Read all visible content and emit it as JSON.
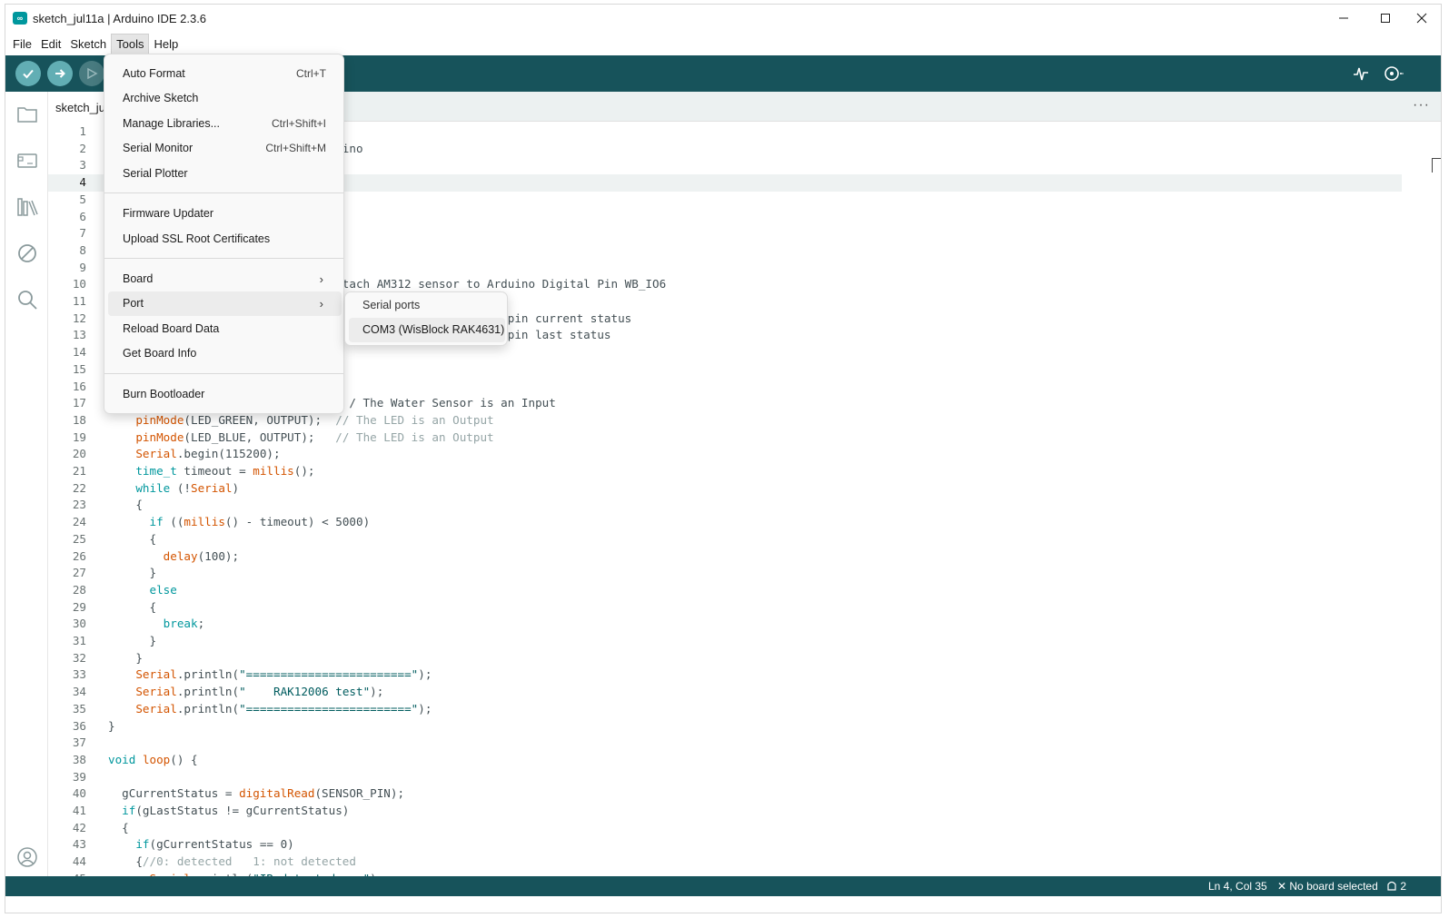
{
  "window": {
    "title": "sketch_jul11a | Arduino IDE 2.3.6",
    "logo_text": "∞",
    "minimize": "—",
    "maximize": "☐",
    "close": "✕"
  },
  "menubar": {
    "items": [
      "File",
      "Edit",
      "Sketch",
      "Tools",
      "Help"
    ],
    "active": "Tools"
  },
  "toolbar": {
    "verify_icon": "check-icon",
    "upload_icon": "arrow-right-icon",
    "debug_icon": "debug-icon",
    "serial_plotter_icon": "plotter-icon",
    "serial_monitor_icon": "monitor-icon"
  },
  "sidebar": {
    "icons": [
      "folder-icon",
      "board-icon",
      "library-icon",
      "debug-off-icon",
      "search-icon",
      "account-icon"
    ]
  },
  "tab": {
    "label": "sketch_jul",
    "more": "···"
  },
  "editor": {
    "current_line": 4,
    "lines": [
      {
        "n": "1",
        "code": ""
      },
      {
        "n": "2",
        "code": "                                  ino"
      },
      {
        "n": "3",
        "code": ""
      },
      {
        "n": "4",
        "code": ""
      },
      {
        "n": "5",
        "code": ""
      },
      {
        "n": "6",
        "code": ""
      },
      {
        "n": "7",
        "code": ""
      },
      {
        "n": "8",
        "code": ""
      },
      {
        "n": "9",
        "code": ""
      },
      {
        "n": "10",
        "code": "                                  tach AM312 sensor to Arduino Digital Pin WB_IO6"
      },
      {
        "n": "11",
        "code": ""
      },
      {
        "n": "12",
        "code": "                                                        e pin current status"
      },
      {
        "n": "13",
        "code": "                                                        e pin last status"
      },
      {
        "n": "14",
        "code": ""
      },
      {
        "n": "15",
        "code": ""
      },
      {
        "n": "16",
        "code": ""
      },
      {
        "n": "17",
        "code": "                                   / The Water Sensor is an Input"
      },
      {
        "n": "18",
        "code": "    pinMode(LED_GREEN, OUTPUT);  // The LED is an Output"
      },
      {
        "n": "19",
        "code": "    pinMode(LED_BLUE, OUTPUT);   // The LED is an Output"
      },
      {
        "n": "20",
        "code": "    Serial.begin(115200);"
      },
      {
        "n": "21",
        "code": "    time_t timeout = millis();"
      },
      {
        "n": "22",
        "code": "    while (!Serial)"
      },
      {
        "n": "23",
        "code": "    {"
      },
      {
        "n": "24",
        "code": "      if ((millis() - timeout) < 5000)"
      },
      {
        "n": "25",
        "code": "      {"
      },
      {
        "n": "26",
        "code": "        delay(100);"
      },
      {
        "n": "27",
        "code": "      }"
      },
      {
        "n": "28",
        "code": "      else"
      },
      {
        "n": "29",
        "code": "      {"
      },
      {
        "n": "30",
        "code": "        break;"
      },
      {
        "n": "31",
        "code": "      }"
      },
      {
        "n": "32",
        "code": "    }"
      },
      {
        "n": "33",
        "code": "    Serial.println(\"========================\");"
      },
      {
        "n": "34",
        "code": "    Serial.println(\"    RAK12006 test\");"
      },
      {
        "n": "35",
        "code": "    Serial.println(\"========================\");"
      },
      {
        "n": "36",
        "code": "}"
      },
      {
        "n": "37",
        "code": ""
      },
      {
        "n": "38",
        "code": "void loop() {"
      },
      {
        "n": "39",
        "code": ""
      },
      {
        "n": "40",
        "code": "  gCurrentStatus = digitalRead(SENSOR_PIN);"
      },
      {
        "n": "41",
        "code": "  if(gLastStatus != gCurrentStatus)"
      },
      {
        "n": "42",
        "code": "  {"
      },
      {
        "n": "43",
        "code": "    if(gCurrentStatus == 0)"
      },
      {
        "n": "44",
        "code": "    {//0: detected   1: not detected"
      },
      {
        "n": "45",
        "code": "      Serial.println(\"IR detected ...\");"
      }
    ]
  },
  "tools_menu": {
    "items": [
      {
        "label": "Auto Format",
        "shortcut": "Ctrl+T"
      },
      {
        "label": "Archive Sketch",
        "shortcut": ""
      },
      {
        "label": "Manage Libraries...",
        "shortcut": "Ctrl+Shift+I"
      },
      {
        "label": "Serial Monitor",
        "shortcut": "Ctrl+Shift+M"
      },
      {
        "label": "Serial Plotter",
        "shortcut": ""
      },
      {
        "label": "Firmware Updater",
        "shortcut": ""
      },
      {
        "label": "Upload SSL Root Certificates",
        "shortcut": ""
      },
      {
        "label": "Board",
        "shortcut": "›"
      },
      {
        "label": "Port",
        "shortcut": "›"
      },
      {
        "label": "Reload Board Data",
        "shortcut": ""
      },
      {
        "label": "Get Board Info",
        "shortcut": ""
      },
      {
        "label": "Burn Bootloader",
        "shortcut": ""
      }
    ]
  },
  "port_menu": {
    "header": "Serial ports",
    "ports": [
      "COM3 (WisBlock RAK4631)"
    ]
  },
  "statusbar": {
    "position": "Ln 4, Col 35",
    "board": "✕ No board selected",
    "notifications": "2",
    "notification_icon": "bell-icon"
  },
  "colors": {
    "teal_dark": "#17535b",
    "teal_button": "#62aeb4",
    "keyword": "#00979d",
    "function": "#d35400",
    "comment": "#95a5a6"
  }
}
